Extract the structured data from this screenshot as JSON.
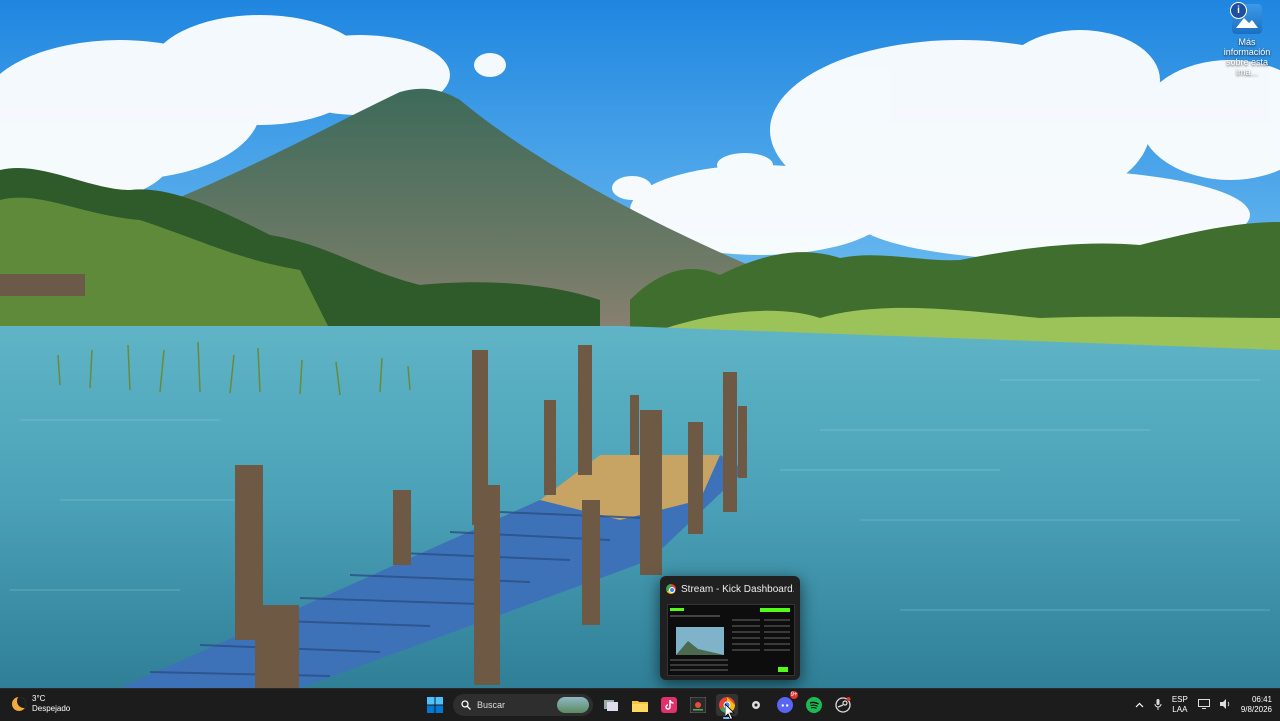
{
  "desktop": {
    "info_icon_label_line1": "Más información",
    "info_icon_label_line2": "sobre esta ima..."
  },
  "preview": {
    "window_title": "Stream - Kick Dashboard..."
  },
  "taskbar": {
    "weather": {
      "temperature": "3°C",
      "condition": "Despejado"
    },
    "search_placeholder": "Buscar",
    "pinned_apps": [
      "start-icon",
      "search",
      "task-view-icon",
      "file-explorer-icon",
      "tiktok-icon",
      "screen-recorder-icon",
      "chrome-icon",
      "extension-icon",
      "discord-icon",
      "spotify-icon",
      "steam-icon"
    ],
    "discord_badge": "9+",
    "tray": {
      "language_line1": "ESP",
      "language_line2": "LAA",
      "time": "06:41",
      "date": "9/8/2026"
    }
  },
  "colors": {
    "taskbar_bg": "#1c1c1c",
    "accent": "#7fbfff"
  }
}
